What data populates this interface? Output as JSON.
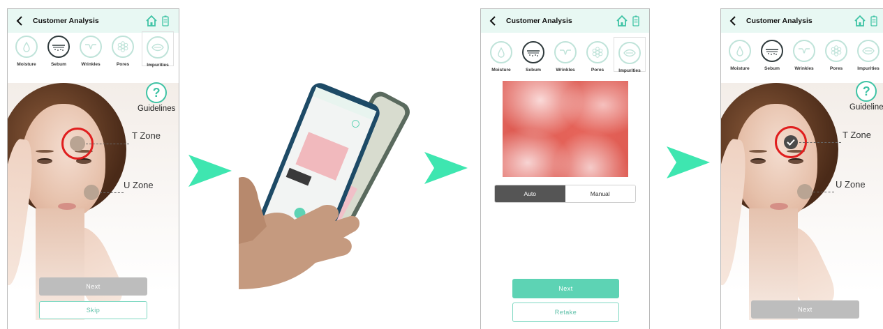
{
  "header": {
    "title": "Customer Analysis"
  },
  "tabs": [
    {
      "label": "Moisture"
    },
    {
      "label": "Sebum"
    },
    {
      "label": "Wrinkles"
    },
    {
      "label": "Pores"
    },
    {
      "label": "Impurities"
    }
  ],
  "guidelines": {
    "label": "Guidelines",
    "label_cropped": "Guideline"
  },
  "zones": {
    "t_zone": "T Zone",
    "u_zone": "U Zone"
  },
  "screen1": {
    "next": "Next",
    "skip": "Skip"
  },
  "screen3": {
    "mode_auto": "Auto",
    "mode_manual": "Manual",
    "next": "Next",
    "retake": "Retake"
  },
  "screen4": {
    "next": "Next"
  },
  "colors": {
    "accent": "#5dd3b4",
    "arrow": "#3ee6b0",
    "header_bg": "#e8f8f3",
    "ring": "#e01e1e"
  }
}
